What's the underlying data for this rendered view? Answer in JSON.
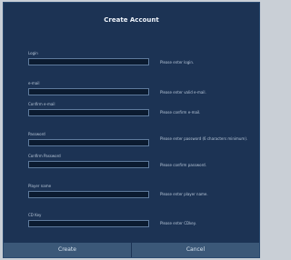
{
  "dialog": {
    "title": "Create Account",
    "create_label": "Create",
    "cancel_label": "Cancel"
  },
  "fields": [
    {
      "label": "Login",
      "hint": "Please enter login.",
      "value": ""
    },
    {
      "label": "e-mail",
      "hint": "Please enter valid e-mail.",
      "value": ""
    },
    {
      "label": "Confirm e-mail",
      "hint": "Please confirm e-mail.",
      "value": ""
    },
    {
      "label": "Password",
      "hint": "Please enter password (6 characters minimum).",
      "value": ""
    },
    {
      "label": "Confirm Password",
      "hint": "Please confirm password.",
      "value": ""
    },
    {
      "label": "Player name",
      "hint": "Please enter player name.",
      "value": ""
    },
    {
      "label": "CD Key",
      "hint": "Please enter CDkey.",
      "value": ""
    }
  ]
}
